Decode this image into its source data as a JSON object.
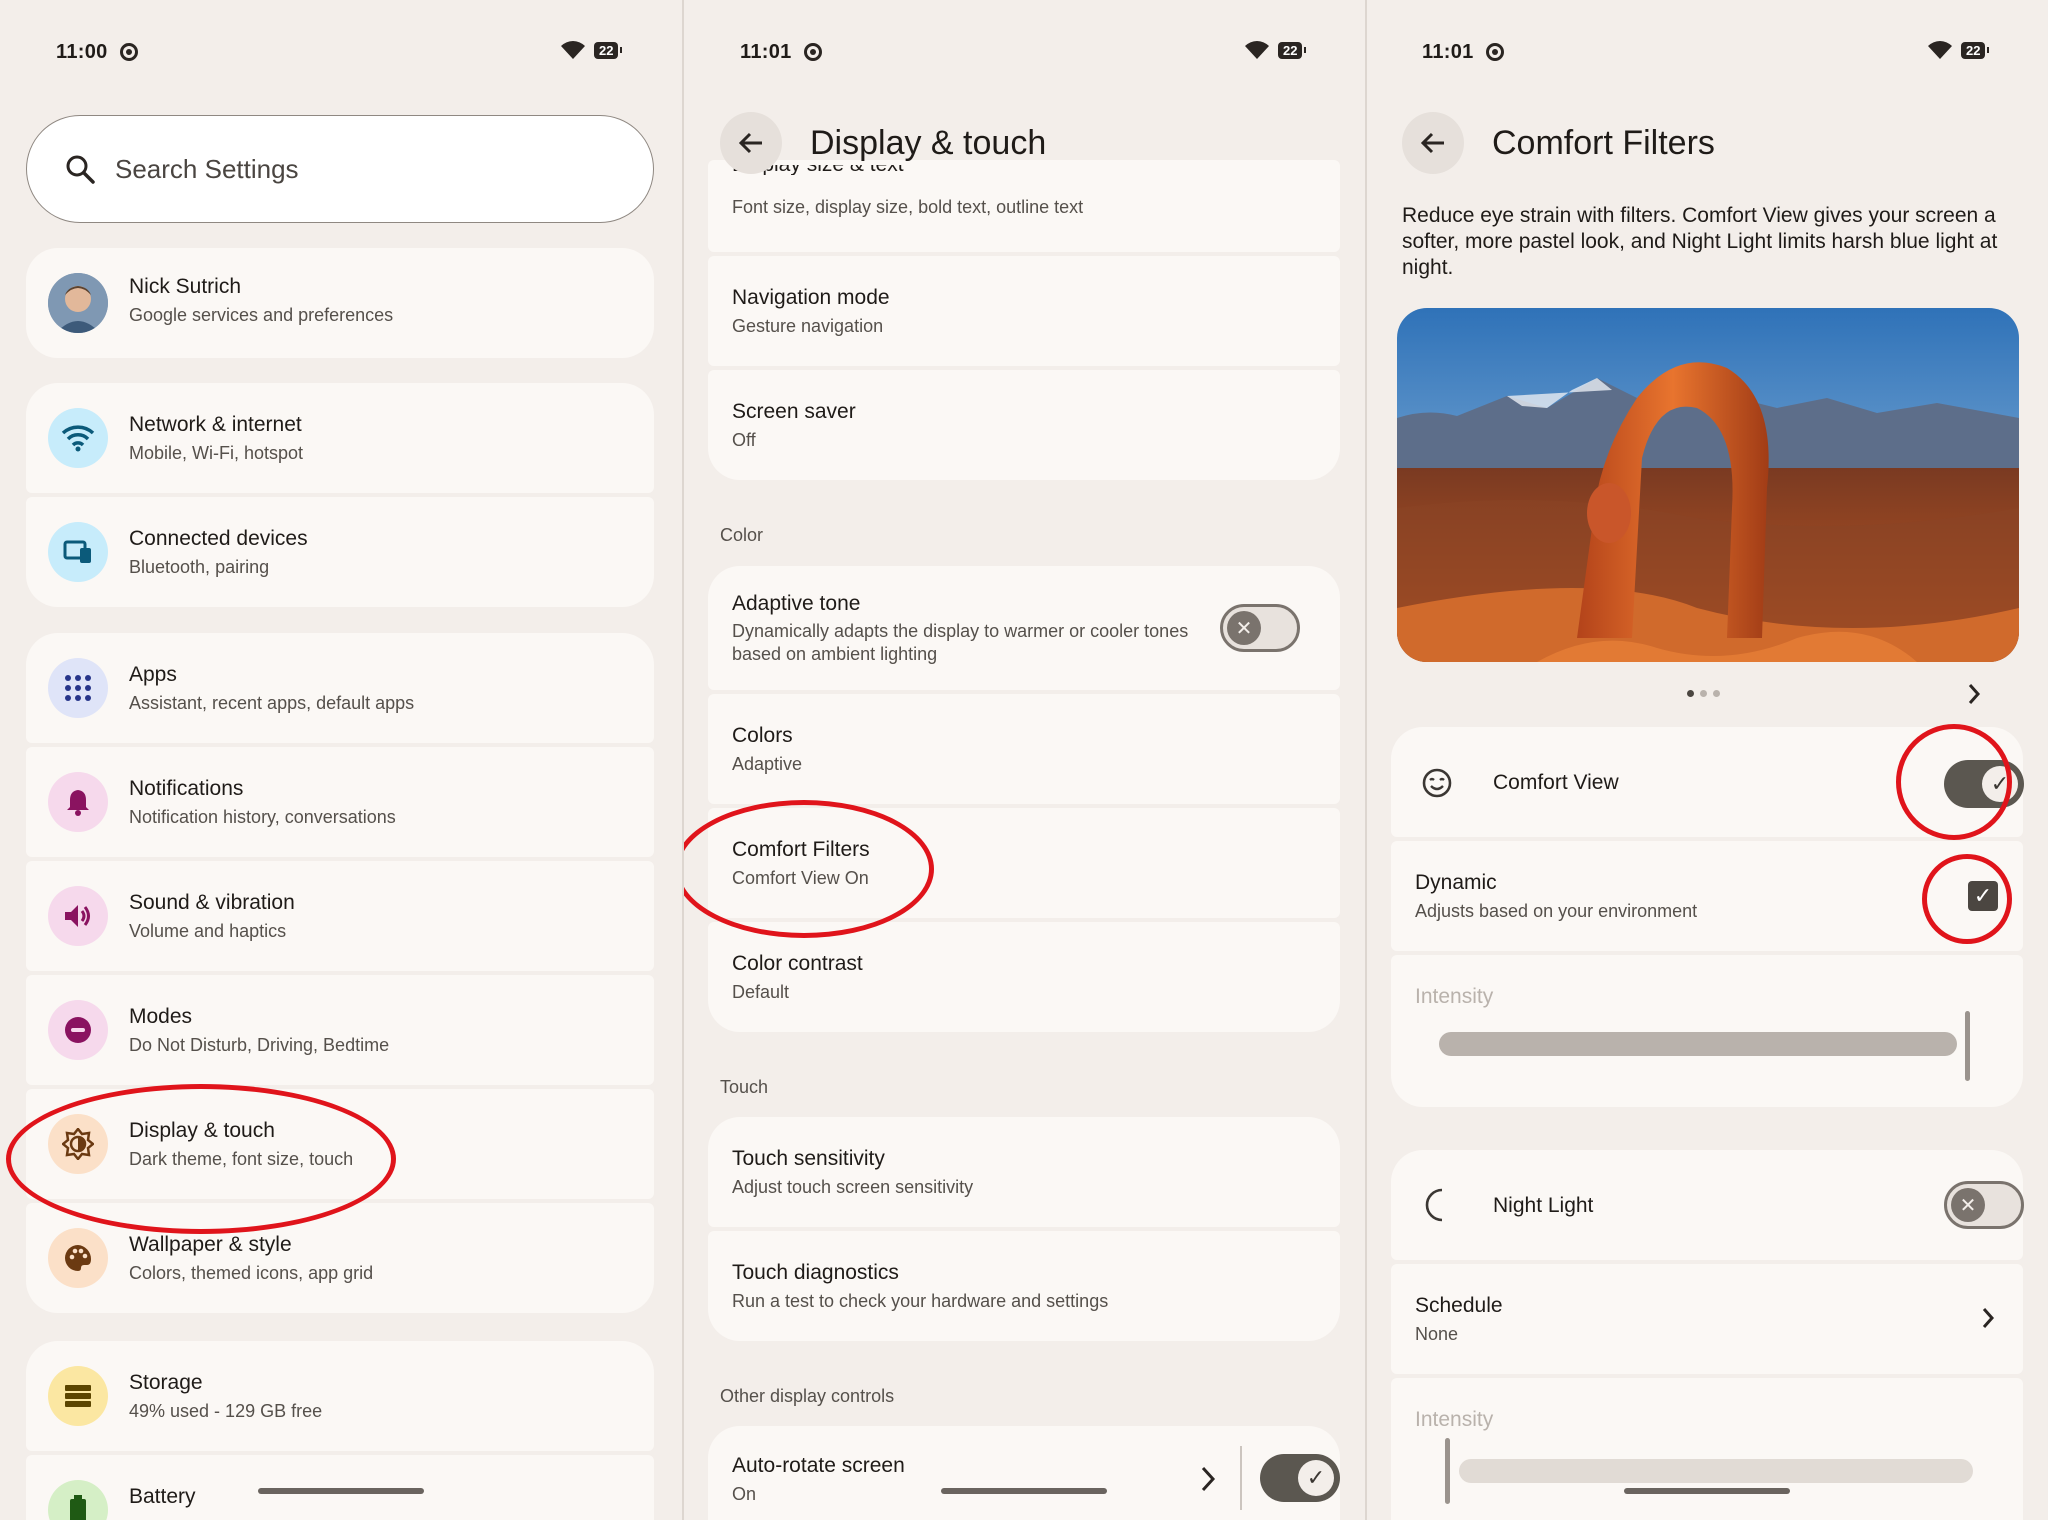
{
  "panel1": {
    "time": "11:00",
    "battery": "22",
    "search_placeholder": "Search Settings",
    "items": [
      {
        "title": "Nick Sutrich",
        "sub": "Google services and preferences"
      },
      {
        "title": "Network & internet",
        "sub": "Mobile, Wi-Fi, hotspot"
      },
      {
        "title": "Connected devices",
        "sub": "Bluetooth, pairing"
      },
      {
        "title": "Apps",
        "sub": "Assistant, recent apps, default apps"
      },
      {
        "title": "Notifications",
        "sub": "Notification history, conversations"
      },
      {
        "title": "Sound & vibration",
        "sub": "Volume and haptics"
      },
      {
        "title": "Modes",
        "sub": "Do Not Disturb, Driving, Bedtime"
      },
      {
        "title": "Display & touch",
        "sub": "Dark theme, font size, touch"
      },
      {
        "title": "Wallpaper & style",
        "sub": "Colors, themed icons, app grid"
      },
      {
        "title": "Storage",
        "sub": "49% used - 129 GB free"
      },
      {
        "title": "Battery",
        "sub": ""
      }
    ],
    "colors": {
      "network": "#c7ecfb",
      "connected": "#c7ecfb",
      "apps": "#dfe4f8",
      "notifications": "#f6d9ec",
      "sound": "#f6d9ec",
      "modes": "#f6d9ec",
      "display": "#fbe0c8",
      "wallpaper": "#fbe0c8",
      "storage": "#fbe7a2",
      "battery": "#d5efc6",
      "highlight": "#e0141b"
    }
  },
  "panel2": {
    "time": "11:01",
    "battery": "22",
    "title": "Display & touch",
    "partial_item": {
      "title": "Display size & text",
      "sub": "Font size, display size, bold text, outline text"
    },
    "items": [
      {
        "title": "Navigation mode",
        "sub": "Gesture navigation"
      },
      {
        "title": "Screen saver",
        "sub": "Off"
      }
    ],
    "section_color": "Color",
    "color_items": [
      {
        "title": "Adaptive tone",
        "sub": "Dynamically adapts the display to warmer or cooler tones based on ambient lighting"
      },
      {
        "title": "Colors",
        "sub": "Adaptive"
      },
      {
        "title": "Comfort Filters",
        "sub": "Comfort View On"
      },
      {
        "title": "Color contrast",
        "sub": "Default"
      }
    ],
    "section_touch": "Touch",
    "touch_items": [
      {
        "title": "Touch sensitivity",
        "sub": "Adjust touch screen sensitivity"
      },
      {
        "title": "Touch diagnostics",
        "sub": "Run a test to check your hardware and settings"
      }
    ],
    "section_other": "Other display controls",
    "other_items": [
      {
        "title": "Auto-rotate screen",
        "sub": "On"
      }
    ]
  },
  "panel3": {
    "time": "11:01",
    "battery": "22",
    "title": "Comfort Filters",
    "description": "Reduce eye strain with filters. Comfort View gives your screen a softer, more pastel look, and Night Light limits harsh blue light at night.",
    "comfort_view": "Comfort View",
    "dynamic_title": "Dynamic",
    "dynamic_sub": "Adjusts based on your environment",
    "intensity": "Intensity",
    "night_light": "Night Light",
    "schedule_title": "Schedule",
    "schedule_sub": "None",
    "intensity2": "Intensity"
  }
}
